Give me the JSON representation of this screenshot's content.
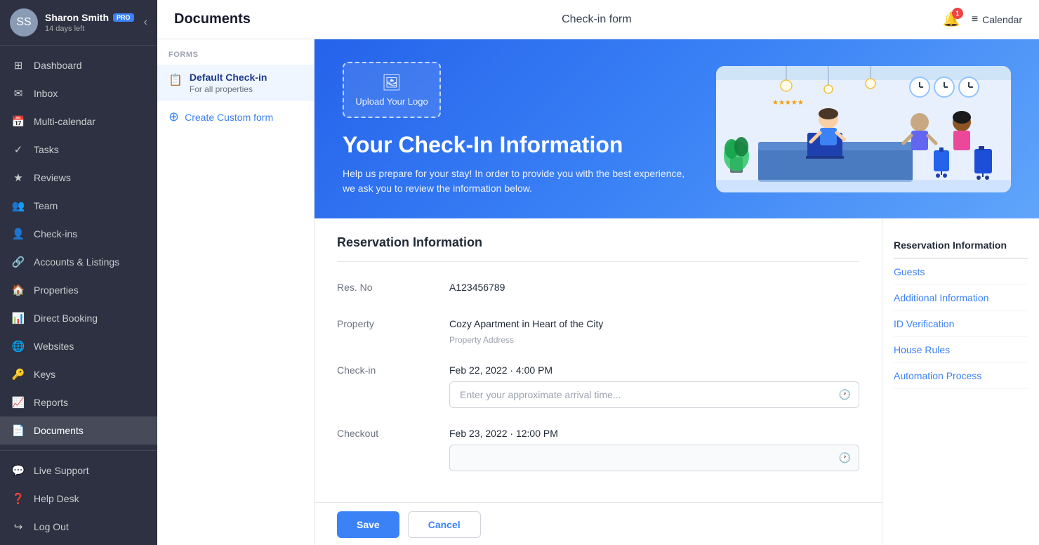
{
  "sidebar": {
    "user": {
      "name": "Sharon Smith",
      "badge": "PRO",
      "days_left": "14 days left",
      "avatar_initials": "SS"
    },
    "nav_items": [
      {
        "id": "dashboard",
        "label": "Dashboard",
        "icon": "⊞"
      },
      {
        "id": "inbox",
        "label": "Inbox",
        "icon": "✉"
      },
      {
        "id": "multi-calendar",
        "label": "Multi-calendar",
        "icon": "📅"
      },
      {
        "id": "tasks",
        "label": "Tasks",
        "icon": "✓"
      },
      {
        "id": "reviews",
        "label": "Reviews",
        "icon": "★"
      },
      {
        "id": "team",
        "label": "Team",
        "icon": "👥"
      },
      {
        "id": "check-ins",
        "label": "Check-ins",
        "icon": "👤"
      },
      {
        "id": "accounts-listings",
        "label": "Accounts & Listings",
        "icon": "🔗"
      },
      {
        "id": "properties",
        "label": "Properties",
        "icon": "🏠"
      },
      {
        "id": "direct-booking",
        "label": "Direct Booking",
        "icon": "📊"
      },
      {
        "id": "websites",
        "label": "Websites",
        "icon": "🌐"
      },
      {
        "id": "keys",
        "label": "Keys",
        "icon": "🔑"
      },
      {
        "id": "reports",
        "label": "Reports",
        "icon": "📈"
      },
      {
        "id": "documents",
        "label": "Documents",
        "icon": "📄",
        "active": true
      }
    ],
    "bottom_items": [
      {
        "id": "live-support",
        "label": "Live Support",
        "icon": "💬"
      },
      {
        "id": "help-desk",
        "label": "Help Desk",
        "icon": "❓"
      },
      {
        "id": "log-out",
        "label": "Log Out",
        "icon": "↪"
      }
    ]
  },
  "topbar": {
    "title": "Documents",
    "form_title": "Check-in form",
    "notification_count": "1",
    "calendar_label": "Calendar"
  },
  "forms_panel": {
    "section_label": "FORMS",
    "items": [
      {
        "id": "default-check-in",
        "name": "Default Check-in",
        "sub": "For all properties",
        "active": true
      }
    ],
    "create_label": "Create Custom form"
  },
  "hero": {
    "upload_text": "Upload Your Logo",
    "title": "Your Check-In Information",
    "description": "Help us prepare for your stay!  In order to provide you with the best experience, we ask you to review the information below."
  },
  "reservation": {
    "section_title": "Reservation Information",
    "fields": [
      {
        "label": "Res. No",
        "value": "A123456789",
        "type": "text"
      },
      {
        "label": "Property",
        "value": "Cozy Apartment in Heart of the City",
        "sub": "Property Address",
        "type": "text"
      },
      {
        "label": "Check-in",
        "value": "Feb 22, 2022 · 4:00 PM",
        "placeholder": "Enter your approximate arrival time...",
        "type": "input"
      },
      {
        "label": "Checkout",
        "value": "Feb 23, 2022 · 12:00 PM",
        "placeholder": "",
        "type": "input"
      }
    ]
  },
  "right_sidebar": {
    "items": [
      {
        "id": "reservation-info",
        "label": "Reservation Information",
        "header": true
      },
      {
        "id": "guests",
        "label": "Guests"
      },
      {
        "id": "additional-info",
        "label": "Additional Information"
      },
      {
        "id": "id-verification",
        "label": "ID Verification"
      },
      {
        "id": "house-rules",
        "label": "House Rules"
      },
      {
        "id": "automation-process",
        "label": "Automation Process"
      }
    ]
  },
  "actions": {
    "save_label": "Save",
    "cancel_label": "Cancel"
  }
}
